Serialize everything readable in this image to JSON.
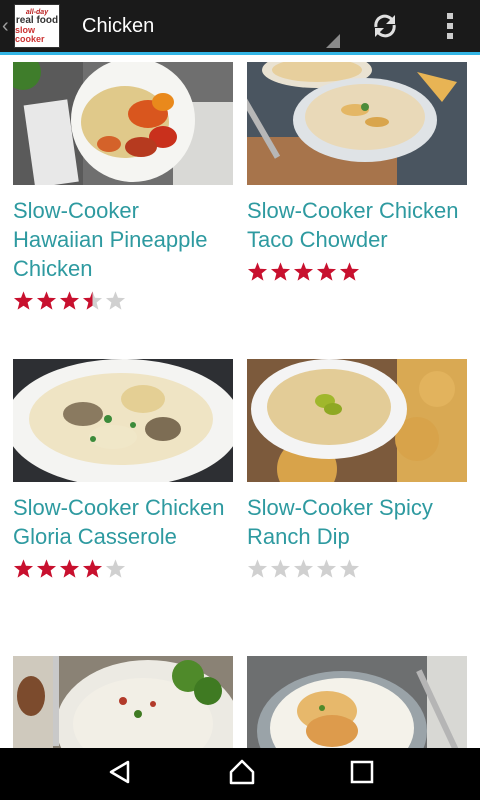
{
  "actionbar": {
    "title": "Chicken",
    "logo_text": [
      "all-day",
      "real food",
      "slow cooker"
    ],
    "refresh_icon": "refresh-icon",
    "overflow_icon": "overflow-menu-icon"
  },
  "colors": {
    "accent": "#33b5e5",
    "recipe_title": "#2e9aa0",
    "star_filled": "#c8102e",
    "star_empty": "#d0d0d0"
  },
  "recipes": [
    {
      "name": "Slow-Cooker Hawaiian Pineapple Chicken",
      "rating": 3.5
    },
    {
      "name": "Slow-Cooker Chicken Taco Chowder",
      "rating": 5
    },
    {
      "name": "Slow-Cooker Chicken Gloria Casserole",
      "rating": 4
    },
    {
      "name": "Slow-Cooker Spicy Ranch Dip",
      "rating": 0
    },
    {
      "name": "",
      "rating": null
    },
    {
      "name": "",
      "rating": null
    }
  ],
  "nav": {
    "back_icon": "back-icon",
    "home_icon": "home-icon",
    "recents_icon": "recents-icon"
  }
}
